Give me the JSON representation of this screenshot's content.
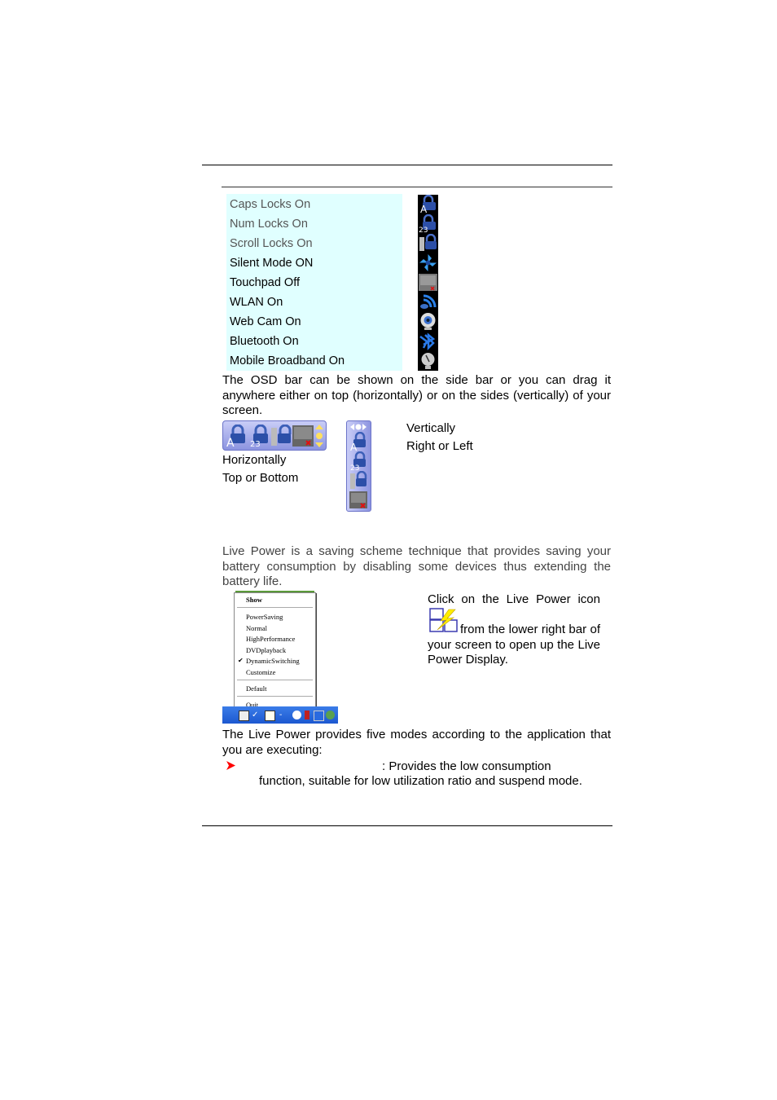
{
  "page": {
    "osd_features": [
      {
        "label": "Caps Locks On",
        "icon": "caps-lock-icon"
      },
      {
        "label": "Num Locks On",
        "icon": "num-lock-icon"
      },
      {
        "label": "Scroll Locks On",
        "icon": "scroll-lock-icon"
      },
      {
        "label": "Silent Mode ON",
        "icon": "silent-mode-icon"
      },
      {
        "label": "Touchpad Off",
        "icon": "touchpad-off-icon"
      },
      {
        "label": "WLAN On",
        "icon": "wlan-icon"
      },
      {
        "label": "Web Cam On",
        "icon": "webcam-icon"
      },
      {
        "label": "Bluetooth On",
        "icon": "bluetooth-icon"
      },
      {
        "label": "Mobile Broadband On",
        "icon": "mobile-broadband-icon"
      }
    ],
    "osd_paragraph": "The OSD bar can be shown on the side bar or you can drag it anywhere either on top (horizontally) or on the sides (vertically) of your screen.",
    "horizontal_caption": [
      "Horizontally",
      "Top or Bottom"
    ],
    "vertical_caption": [
      "Vertically",
      "Right or Left"
    ],
    "live_power_paragraph": "Live Power is a saving scheme technique that provides saving your battery consumption by disabling some devices thus extending the battery life.",
    "click_instruction_part1": "Click on the Live Power icon",
    "click_instruction_part2": "from the lower right bar of your screen to open up the Live Power Display.",
    "context_menu": {
      "items": [
        "Show",
        "PowerSaving",
        "Normal",
        "HighPerformance",
        "DVDplayback",
        "DynamicSwitching",
        "Customize",
        "Default",
        "Quit"
      ],
      "checked": "DynamicSwitching"
    },
    "modes_paragraph": "The Live Power provides five modes according to the application that you are executing:",
    "bullet_text_line1": ": Provides the low consumption",
    "bullet_text_line2": "function, suitable for low utilization ratio and suspend mode."
  },
  "colors": {
    "table_bg": "#e0ffff",
    "osd_bar": "#9aa2e8",
    "taskbar": "#2a6ae0",
    "bullet": "#ff0000"
  }
}
